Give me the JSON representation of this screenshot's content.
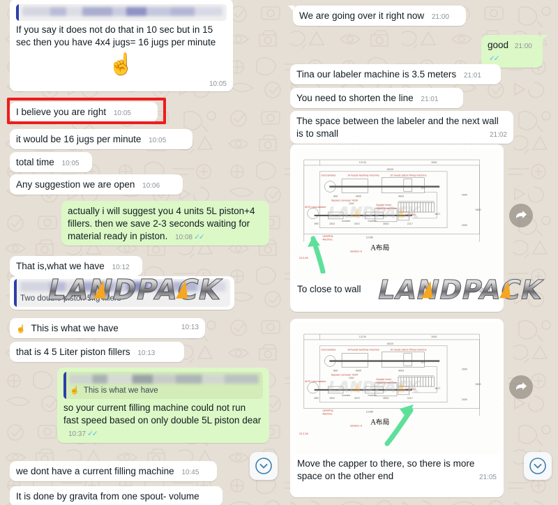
{
  "app": {
    "name": "WhatsApp Chat Screenshot",
    "watermark_text": "LANDPACK"
  },
  "colors": {
    "chat_background": "#e6dfd6",
    "incoming_bubble": "#ffffff",
    "outgoing_bubble": "#dcf8c6",
    "quote_bar": "#2c3ea8",
    "tick_blue": "#53bdeb",
    "annotation_red": "#ee1c1c",
    "marker_green": "#5fe09a",
    "diagram_red_label": "#d94a3d"
  },
  "left_column": {
    "messages": [
      {
        "id": "msg-quoted-jugs",
        "direction": "in",
        "quote": {
          "sender_blurred": true,
          "text": ""
        },
        "text": "If you say it does not do that in 10 sec but in 15 sec then you have 4x4 jugs= 16 jugs per minute",
        "emoji": "☝️",
        "time": "10:05",
        "ticks": false
      },
      {
        "id": "msg-believe",
        "direction": "in",
        "text": "I believe you are right",
        "time": "10:05",
        "ticks": false,
        "highlighted": true
      },
      {
        "id": "msg-16jugs",
        "direction": "in",
        "text": "it would be 16 jugs per minute",
        "time": "10:05",
        "ticks": false
      },
      {
        "id": "msg-total-time",
        "direction": "in",
        "text": "total time",
        "time": "10:05",
        "ticks": false
      },
      {
        "id": "msg-any-suggestion",
        "direction": "in",
        "text": "Any suggestion we are open",
        "time": "10:06",
        "ticks": false
      },
      {
        "id": "msg-suggest-4units",
        "direction": "out",
        "text": "actually i will suggest you 4 units 5L piston+4 fillers.  then we save 2-3 seconds waiting for material ready in piston.",
        "time": "10:08",
        "ticks": true
      },
      {
        "id": "msg-that-is-what-we-have",
        "direction": "in",
        "text": "That is,what we have",
        "time": "10:12",
        "ticks": false
      },
      {
        "id": "msg-quoted-two-double-piston",
        "direction": "in",
        "quote": {
          "sender_blurred": true,
          "text": ""
        },
        "text": "Two double piston 5kg fillers",
        "time": "",
        "ticks": false
      },
      {
        "id": "msg-this-is-what-we-have",
        "direction": "in",
        "emoji": "☝️",
        "text": "This is what we have",
        "time": "10:13",
        "ticks": false
      },
      {
        "id": "msg-4-5liter",
        "direction": "in",
        "text": "that is 4 5 Liter piston fillers",
        "time": "10:13",
        "ticks": false
      },
      {
        "id": "msg-current-filling-machine",
        "direction": "out",
        "quote": {
          "sender_blurred": true,
          "text": "This is what we have",
          "emoji": "☝️"
        },
        "text": "so your current filling machine could not run fast speed based on only double 5L piston dear",
        "time": "10:37",
        "ticks": true
      },
      {
        "id": "msg-dont-have-current",
        "direction": "in",
        "text": "we dont have a current filling machine",
        "time": "10:45",
        "ticks": false
      },
      {
        "id": "msg-gravita",
        "direction": "in",
        "text": "It is done by gravita from one spout- volume",
        "time": "",
        "ticks": false
      }
    ]
  },
  "right_column": {
    "messages": [
      {
        "id": "msg-going-over",
        "direction": "in",
        "text": "We are going over it right now",
        "time": "21:00",
        "ticks": false
      },
      {
        "id": "msg-good",
        "direction": "out",
        "text": "good",
        "time": "21:00",
        "ticks": true
      },
      {
        "id": "msg-labeler-35m",
        "direction": "in",
        "text": "Tina our labeler machine is 3.5 meters",
        "time": "21:01",
        "ticks": false
      },
      {
        "id": "msg-shorten-line",
        "direction": "in",
        "text": "You need to shorten the line",
        "time": "21:01",
        "ticks": false
      },
      {
        "id": "msg-space-too-small",
        "direction": "in",
        "text": "The space between the labeler and the next wall is to small",
        "time": "21:02",
        "ticks": false
      },
      {
        "id": "msg-image-close-to-wall",
        "direction": "in",
        "type": "image",
        "caption": "To close to wall",
        "time": "21:03",
        "ticks": false,
        "annotation": "green-arrow-left"
      },
      {
        "id": "msg-image-move-capper",
        "direction": "in",
        "type": "image",
        "caption": "Move the capper to there, so there is more space on the other end",
        "time": "21:05",
        "ticks": false,
        "annotation": "green-arrow-right"
      }
    ]
  },
  "diagram": {
    "title_cn": "A布局",
    "solution_label": "Solution A",
    "date_code": "23.3.28",
    "top_dimension": "12130",
    "second_dimension": "10020",
    "right_dimension_top": "2000",
    "right_dimension_mid": "1600",
    "right_dimension_bottom": "2000",
    "right_dimension_total": "5400",
    "inner_dimension": "2817",
    "bottom_dimension": "12186",
    "labels": [
      "Unscrambler",
      "14 heads washing machine",
      "10 heads piston filling machine",
      "Double head capping machine",
      "Bypass conveyor 4200",
      "Cap lifter",
      "Labelling Machine",
      "Inverter",
      "4070 Unscrambler"
    ],
    "numbers": [
      "890",
      "4000",
      "4003",
      "501",
      "2002",
      "1001",
      "3072",
      "3004",
      "2217",
      "890"
    ]
  },
  "controls": {
    "scroll_to_bottom_left": "chevron-down-icon",
    "scroll_to_bottom_right": "chevron-down-icon",
    "forward_button": "forward-arrow-icon"
  }
}
